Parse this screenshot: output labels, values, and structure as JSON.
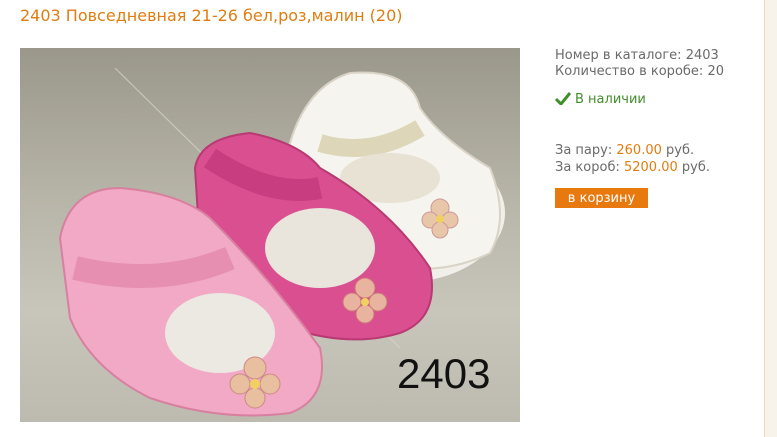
{
  "product": {
    "title": "2403 Повседневная 21-26 бел,роз,малин (20)",
    "photo_code": "2403"
  },
  "info": {
    "catalog_label": "Номер в каталоге:",
    "catalog_value": "2403",
    "qty_label": "Количество в коробе:",
    "qty_value": "20",
    "stock": "В наличии",
    "pair_label": "За пару:",
    "pair_price": "260.00",
    "box_label": "За короб:",
    "box_price": "5200.00",
    "currency": "руб.",
    "cart_button": "в корзину"
  },
  "colors": {
    "accent": "#e8790f",
    "title": "#e07d10",
    "stock": "#3f8f2a"
  }
}
